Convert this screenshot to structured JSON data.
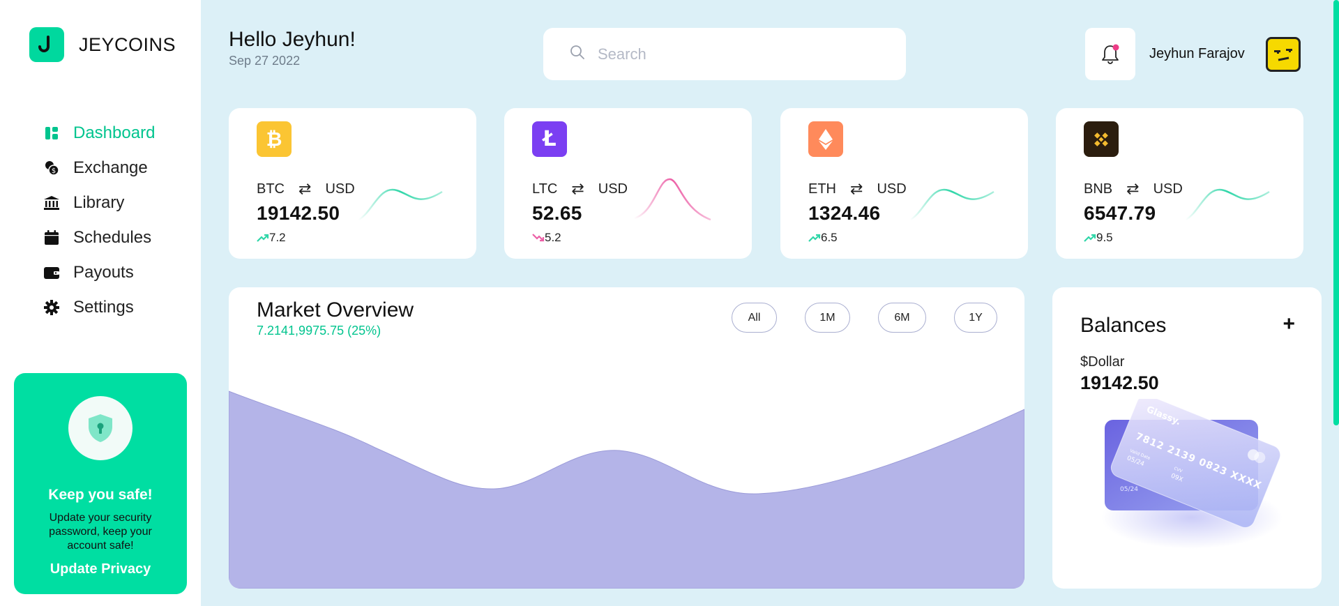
{
  "brand": {
    "name": "JEYCOINS"
  },
  "nav": [
    {
      "label": "Dashboard",
      "icon": "dashboard-icon",
      "active": true
    },
    {
      "label": "Exchange",
      "icon": "exchange-icon"
    },
    {
      "label": "Library",
      "icon": "library-icon"
    },
    {
      "label": "Schedules",
      "icon": "calendar-icon"
    },
    {
      "label": "Payouts",
      "icon": "wallet-icon"
    },
    {
      "label": "Settings",
      "icon": "gear-icon"
    }
  ],
  "safe_card": {
    "title": "Keep you safe!",
    "text": "Update your security password, keep your account safe!",
    "link": "Update Privacy"
  },
  "header": {
    "greeting": "Hello Jeyhun!",
    "date": "Sep 27 2022",
    "search_placeholder": "Search",
    "user_name": "Jeyhun Farajov"
  },
  "coins": [
    {
      "symbol": "BTC",
      "quote": "USD",
      "price": "19142.50",
      "change": "7.2",
      "trend": "up",
      "color": "#fbc533"
    },
    {
      "symbol": "LTC",
      "quote": "USD",
      "price": "52.65",
      "change": "5.2",
      "trend": "down",
      "color": "#7b3ff2"
    },
    {
      "symbol": "ETH",
      "quote": "USD",
      "price": "1324.46",
      "change": "6.5",
      "trend": "up",
      "color": "#ff8a5b"
    },
    {
      "symbol": "BNB",
      "quote": "USD",
      "price": "6547.79",
      "change": "9.5",
      "trend": "up",
      "color": "#2b1d0e"
    }
  ],
  "market": {
    "title": "Market Overview",
    "subtitle": "7.2141,9975.75 (25%)",
    "ranges": [
      "All",
      "1M",
      "6M",
      "1Y"
    ],
    "fill_color": "#b4b4e8"
  },
  "balances": {
    "title": "Balances",
    "add_label": "+",
    "currency": "$Dollar",
    "amount": "19142.50",
    "card_brand": "Glassy.",
    "card_number": "7812 2139 0823 XXXX",
    "card_valid_label": "Valid Date",
    "card_valid": "05/24",
    "card_cvv_label": "CVV",
    "card_cvv": "09X"
  },
  "colors": {
    "accent": "#00dea2",
    "up": "#2fd6a8",
    "down": "#ec5fa6"
  }
}
